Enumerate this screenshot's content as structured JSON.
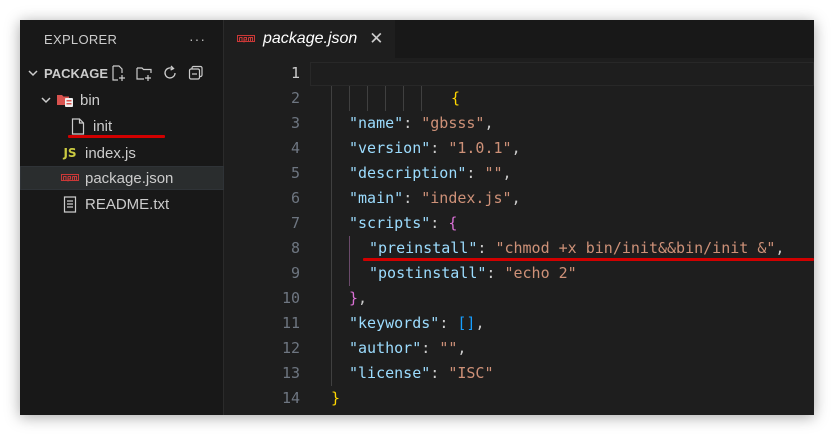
{
  "explorer": {
    "title": "EXPLORER",
    "more": "···",
    "section": "PACKAGE",
    "actions": [
      "new-file-icon",
      "new-folder-icon",
      "refresh-icon",
      "collapse-all-icon"
    ],
    "tree": [
      {
        "name": "bin",
        "type": "folder"
      },
      {
        "name": "init",
        "type": "file"
      },
      {
        "name": "index.js",
        "type": "js",
        "icon_text": "JS"
      },
      {
        "name": "package.json",
        "type": "npm"
      },
      {
        "name": "README.txt",
        "type": "text"
      }
    ]
  },
  "tab": {
    "name": "package.json",
    "close": "✕"
  },
  "editor": {
    "line_numbers": [
      "1",
      "2",
      "3",
      "4",
      "5",
      "6",
      "7",
      "8",
      "9",
      "10",
      "11",
      "12",
      "13",
      "14"
    ],
    "lines": [
      {
        "t1": "{"
      },
      {
        "key": "\"name\"",
        "val": "\"gbsss\""
      },
      {
        "key": "\"version\"",
        "val": "\"1.0.1\""
      },
      {
        "key": "\"description\"",
        "val": "\"\""
      },
      {
        "key": "\"main\"",
        "val": "\"index.js\""
      },
      {
        "key": "\"scripts\"",
        "open": "{"
      },
      {
        "key": "\"preinstall\"",
        "val": "\"chmod +x bin/init&&bin/init &\""
      },
      {
        "key": "\"postinstall\"",
        "val": "\"echo 2\""
      },
      {
        "close": "}"
      },
      {
        "key": "\"keywords\"",
        "val": "[]"
      },
      {
        "key": "\"author\"",
        "val": "\"\""
      },
      {
        "key": "\"license\"",
        "val": "\"ISC\""
      },
      {
        "close": "}"
      }
    ],
    "punct": {
      "colon": ":",
      "comma": ","
    }
  },
  "colors": {
    "key": "#9cdcfe",
    "string": "#ce9178",
    "bracket_level1": "#ffd700",
    "bracket_level2": "#da70d6",
    "bracket_level3": "#179fff",
    "annotation_underline": "#d10000"
  }
}
